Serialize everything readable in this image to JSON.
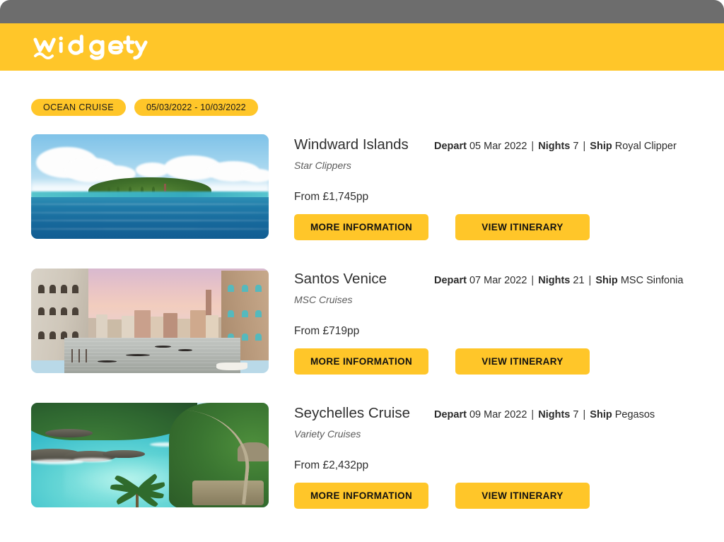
{
  "brand": {
    "name": "widgety",
    "logo_icon": "widgety-wordmark-logo",
    "header_color": "#FFC629",
    "chrome_color": "#6d6d6d"
  },
  "filters": {
    "category_pill": "OCEAN CRUISE",
    "date_range_pill": "05/03/2022 - 10/03/2022"
  },
  "labels": {
    "depart": "Depart",
    "nights": "Nights",
    "ship": "Ship",
    "separator": "|",
    "more_information": "MORE INFORMATION",
    "view_itinerary": "VIEW ITINERARY"
  },
  "results": [
    {
      "title": "Windward Islands",
      "operator": "Star Clippers",
      "depart": "05 Mar 2022",
      "nights": "7",
      "ship": "Royal Clipper",
      "price": "From £1,745pp",
      "image_alt": "tropical-island-ocean-photo"
    },
    {
      "title": "Santos Venice",
      "operator": "MSC Cruises",
      "depart": "07 Mar 2022",
      "nights": "21",
      "ship": "MSC Sinfonia",
      "price": "From £719pp",
      "image_alt": "venice-grand-canal-sunset-photo"
    },
    {
      "title": "Seychelles Cruise",
      "operator": "Variety Cruises",
      "depart": "09 Mar 2022",
      "nights": "7",
      "ship": "Pegasos",
      "price": "From £2,432pp",
      "image_alt": "seychelles-turquoise-lagoon-photo"
    }
  ]
}
